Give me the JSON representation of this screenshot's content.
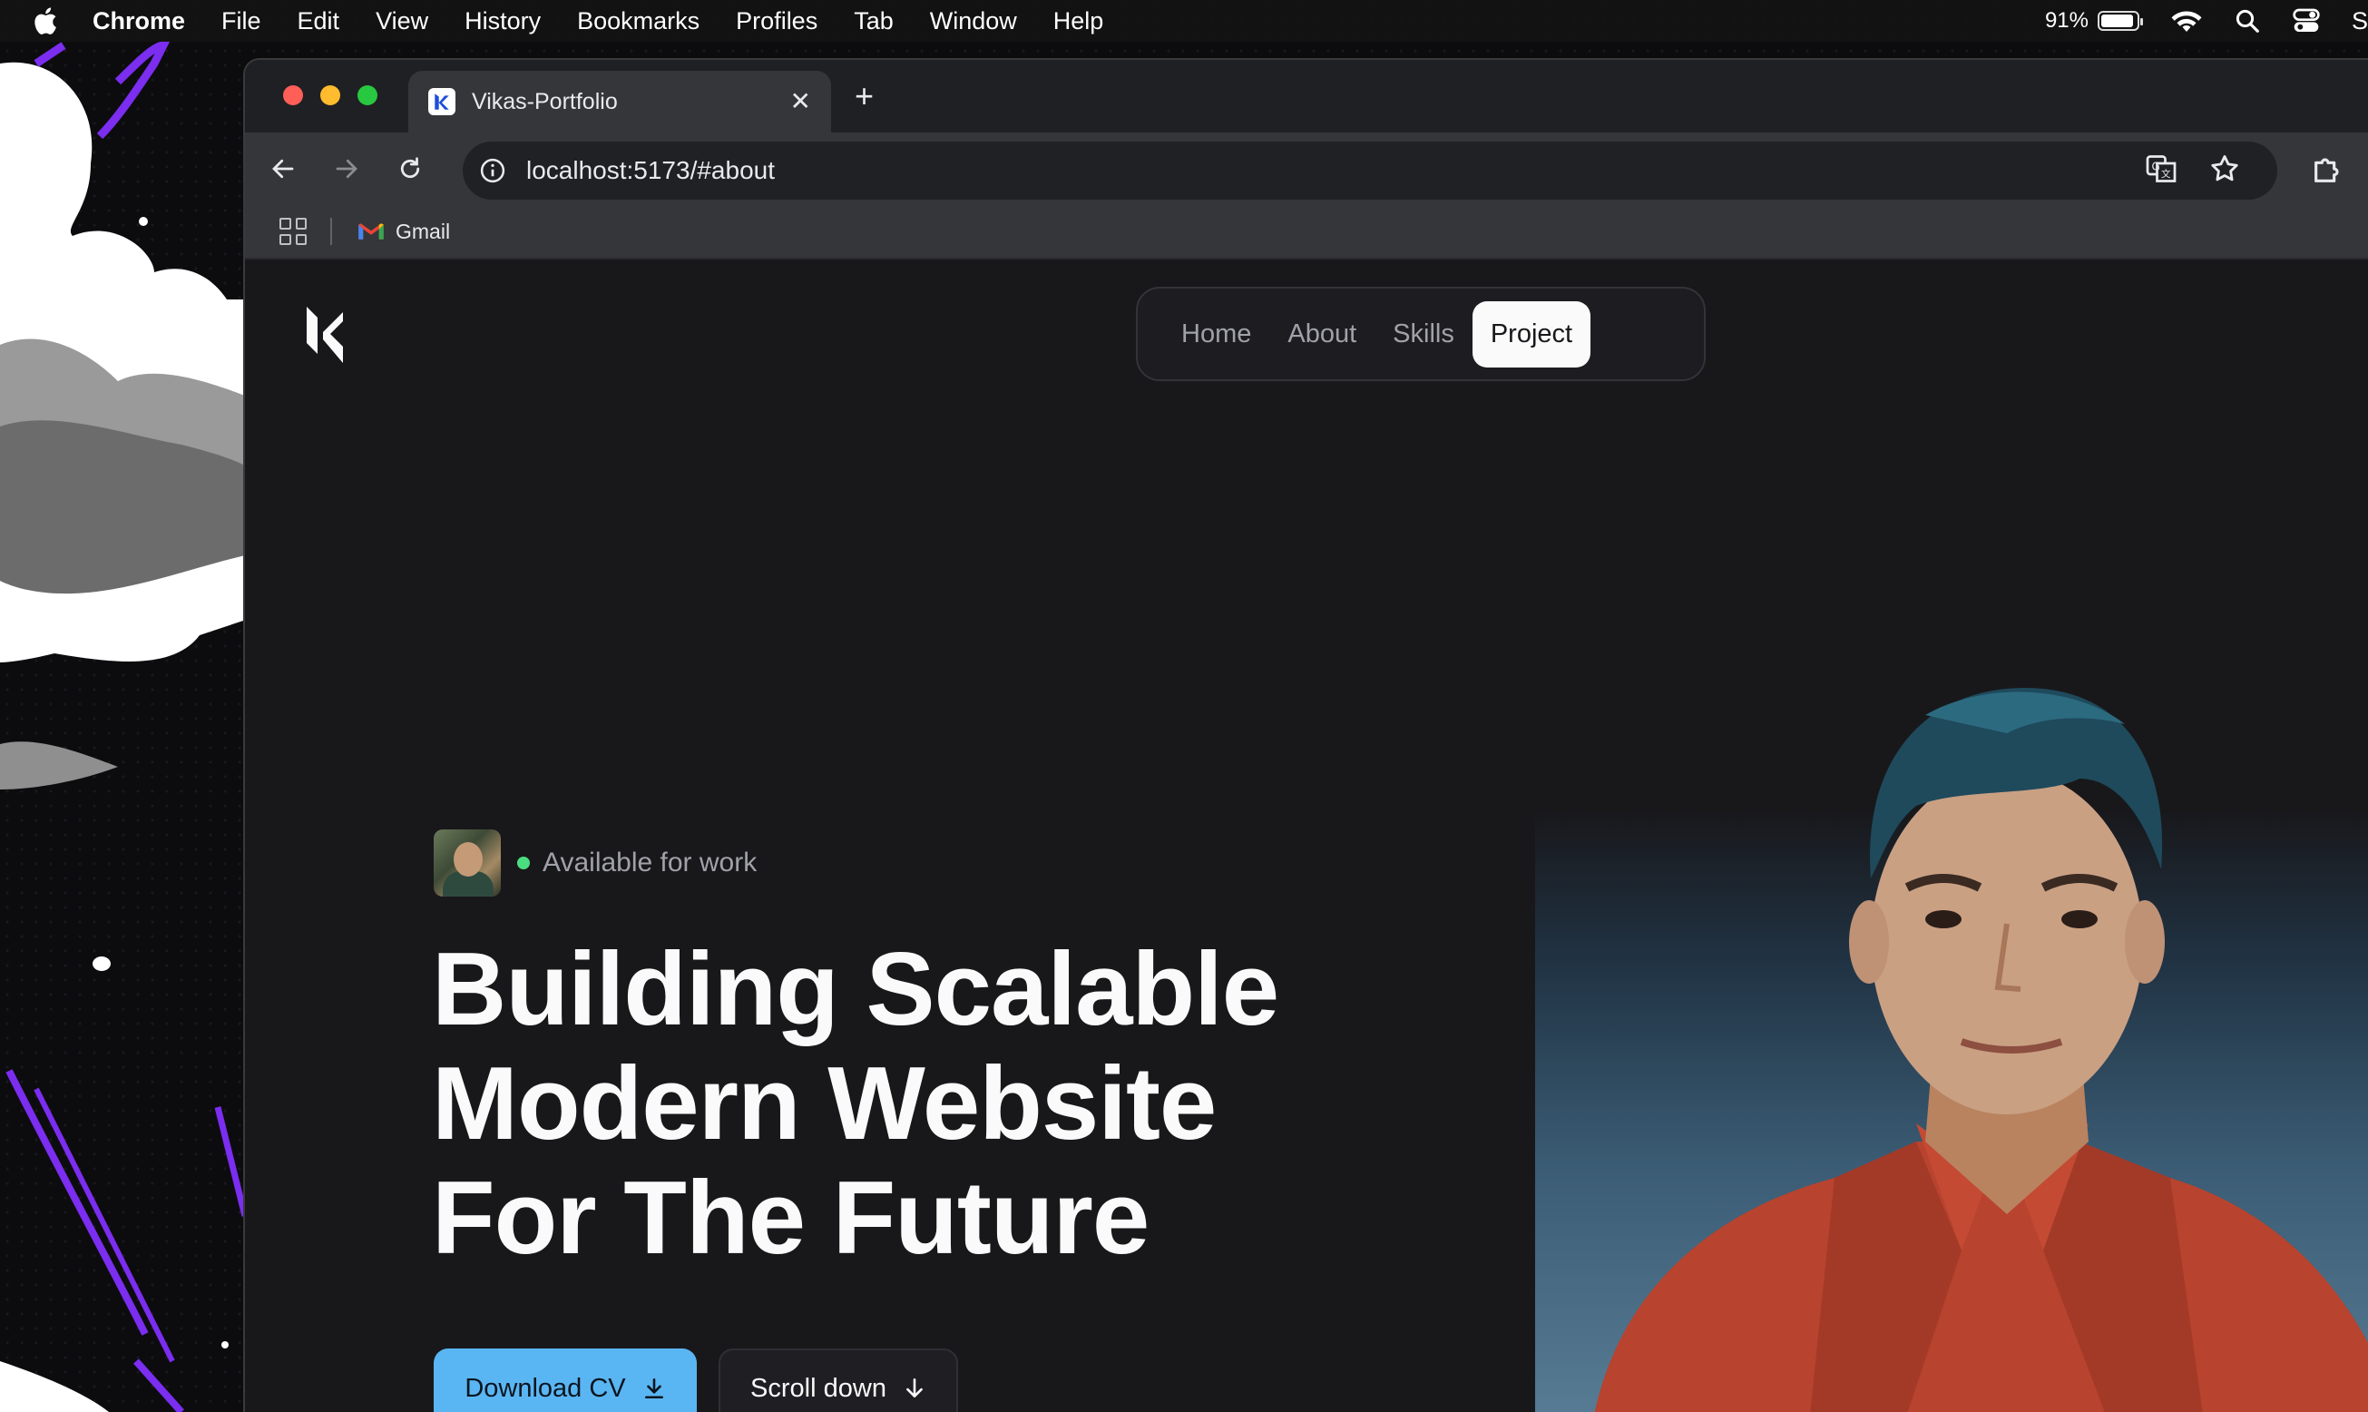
{
  "menubar": {
    "app_name": "Chrome",
    "items": [
      "File",
      "Edit",
      "View",
      "History",
      "Bookmarks",
      "Profiles",
      "Tab",
      "Window",
      "Help"
    ],
    "battery_percent": "91%",
    "battery_level": 0.91,
    "cut_off_text": "S"
  },
  "browser": {
    "tab_title": "Vikas-Portfolio",
    "url": "localhost:5173/#about",
    "bookmarks": [
      {
        "label": "Gmail",
        "icon": "gmail-icon"
      }
    ]
  },
  "page": {
    "nav": {
      "links": [
        "Home",
        "About",
        "Skills",
        "Project"
      ],
      "active": "Project"
    },
    "status_text": "Available for work",
    "headline": [
      "Building Scalable",
      "Modern Website",
      "For The Future"
    ],
    "buttons": {
      "primary": "Download CV",
      "secondary": "Scroll down"
    },
    "colors": {
      "accent": "#5ab6f2",
      "status_dot": "#4ade80",
      "page_bg": "#18181b"
    }
  }
}
